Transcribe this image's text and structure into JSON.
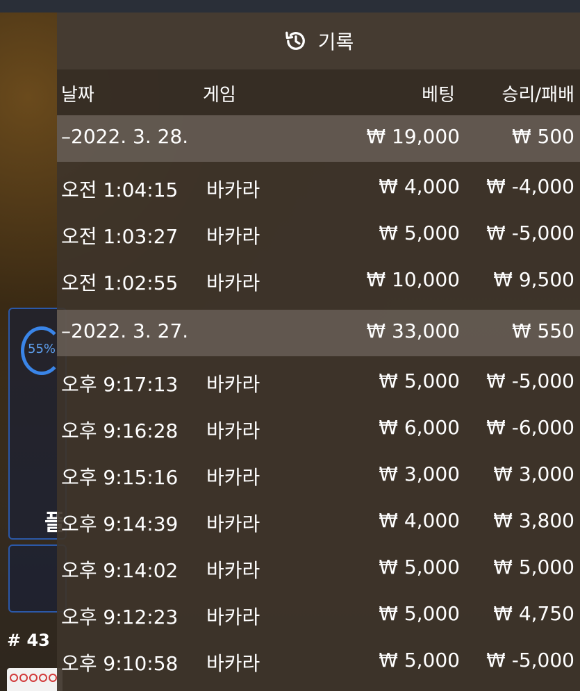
{
  "history": {
    "title": "기록",
    "columns": {
      "date": "날짜",
      "game": "게임",
      "bet": "베팅",
      "result": "승리/패배"
    },
    "groups": [
      {
        "date": "–2022. 3. 28.",
        "total_bet": "₩ 19,000",
        "total_result": "₩ 500",
        "rows": [
          {
            "time": "오전 1:04:15",
            "game": "바카라",
            "bet": "₩ 4,000",
            "result": "₩ -4,000"
          },
          {
            "time": "오전 1:03:27",
            "game": "바카라",
            "bet": "₩ 5,000",
            "result": "₩ -5,000"
          },
          {
            "time": "오전 1:02:55",
            "game": "바카라",
            "bet": "₩ 10,000",
            "result": "₩ 9,500"
          }
        ]
      },
      {
        "date": "–2022. 3. 27.",
        "total_bet": "₩ 33,000",
        "total_result": "₩ 550",
        "rows": [
          {
            "time": "오후 9:17:13",
            "game": "바카라",
            "bet": "₩ 5,000",
            "result": "₩ -5,000"
          },
          {
            "time": "오후 9:16:28",
            "game": "바카라",
            "bet": "₩ 6,000",
            "result": "₩ -6,000"
          },
          {
            "time": "오후 9:15:16",
            "game": "바카라",
            "bet": "₩ 3,000",
            "result": "₩ 3,000"
          },
          {
            "time": "오후 9:14:39",
            "game": "바카라",
            "bet": "₩ 4,000",
            "result": "₩ 3,800"
          },
          {
            "time": "오후 9:14:02",
            "game": "바카라",
            "bet": "₩ 5,000",
            "result": "₩ 5,000"
          },
          {
            "time": "오후 9:12:23",
            "game": "바카라",
            "bet": "₩ 5,000",
            "result": "₩ 4,750"
          },
          {
            "time": "오후 9:10:58",
            "game": "바카라",
            "bet": "₩ 5,000",
            "result": "₩ -5,000"
          }
        ]
      }
    ]
  },
  "side": {
    "progress_label": "55%",
    "progress": 0.55,
    "glyph": "플",
    "round": "# 43"
  },
  "colors": {
    "accent": "#3a85e8",
    "panel": "#3e342a",
    "group_row": "#6e645c"
  },
  "icons": {
    "history": "history-clock-icon"
  }
}
